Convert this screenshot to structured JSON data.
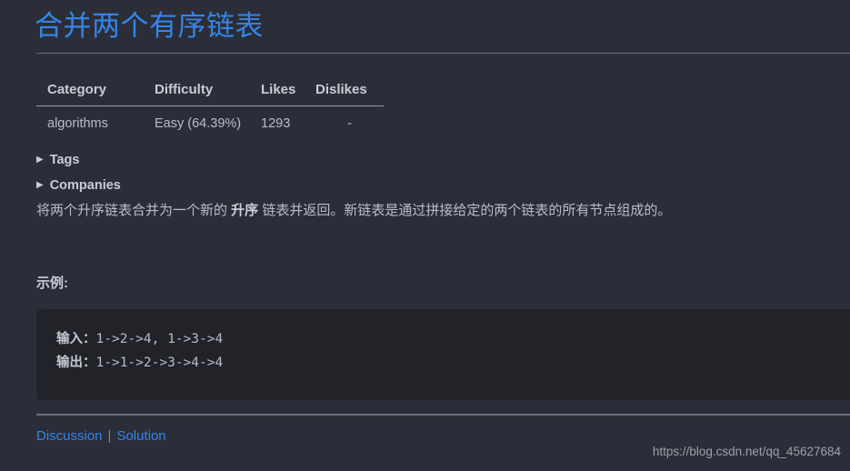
{
  "problem": {
    "title": "合并两个有序链表"
  },
  "info_table": {
    "headers": [
      "Category",
      "Difficulty",
      "Likes",
      "Dislikes"
    ],
    "rows": [
      {
        "category": "algorithms",
        "difficulty": "Easy (64.39%)",
        "likes": "1293",
        "dislikes": "-"
      }
    ]
  },
  "collapsibles": [
    {
      "label": "Tags",
      "caret": "▶",
      "expanded": false
    },
    {
      "label": "Companies",
      "caret": "▶",
      "expanded": false
    }
  ],
  "description": {
    "part1": "将两个升序链表合并为一个新的 ",
    "emphasis": "升序",
    "part2": " 链表并返回。新链表是通过拼接给定的两个链表的所有节点组成的。"
  },
  "example": {
    "heading": "示例:",
    "lines": [
      {
        "label": "输入：",
        "value": "1->2->4, 1->3->4"
      },
      {
        "label": "输出：",
        "value": "1->1->2->3->4->4"
      }
    ]
  },
  "footer": {
    "discussion_label": "Discussion",
    "separator": "|",
    "solution_label": "Solution",
    "watermark": "https://blog.csdn.net/qq_45627684"
  },
  "colors": {
    "page_background": "#2b2e38",
    "code_background": "#212329",
    "link_blue": "#3385e8",
    "text_gray": "#b9bdc9",
    "heading_gray": "#c8ccd6",
    "rule_gray": "#6b7080"
  }
}
